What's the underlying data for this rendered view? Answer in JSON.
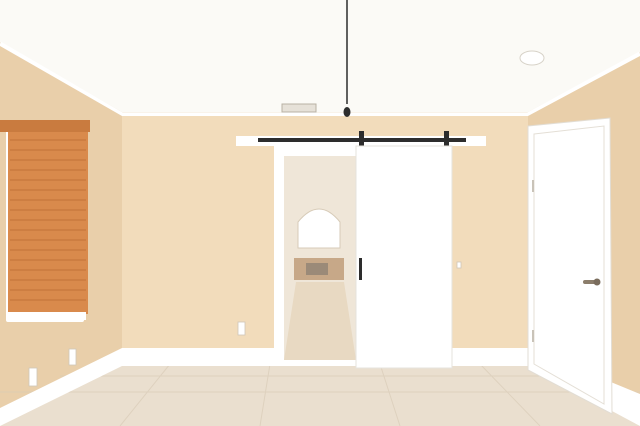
{
  "scene": {
    "kind": "empty interior room with sliding barn door",
    "colors": {
      "ceiling": "#fbfaf6",
      "wall": "#f2dcbb",
      "wall_shadow": "#e9cfaa",
      "trim": "#ffffff",
      "floor": "#eadfcf",
      "floor_grout": "#d9ccb8",
      "blind": "#d98a4c",
      "blind_slat": "#c97b3f",
      "barn_door": "#ffffff",
      "track": "#2d2d2d",
      "hallway_floor": "#e8d9c2",
      "bathroom_wall": "#efe6d8",
      "vanity": "#c7a888"
    },
    "icons": [
      "barn-door-track-icon",
      "door-handle-icon",
      "pendant-light-icon",
      "air-vent-icon",
      "outlet-icon"
    ]
  }
}
